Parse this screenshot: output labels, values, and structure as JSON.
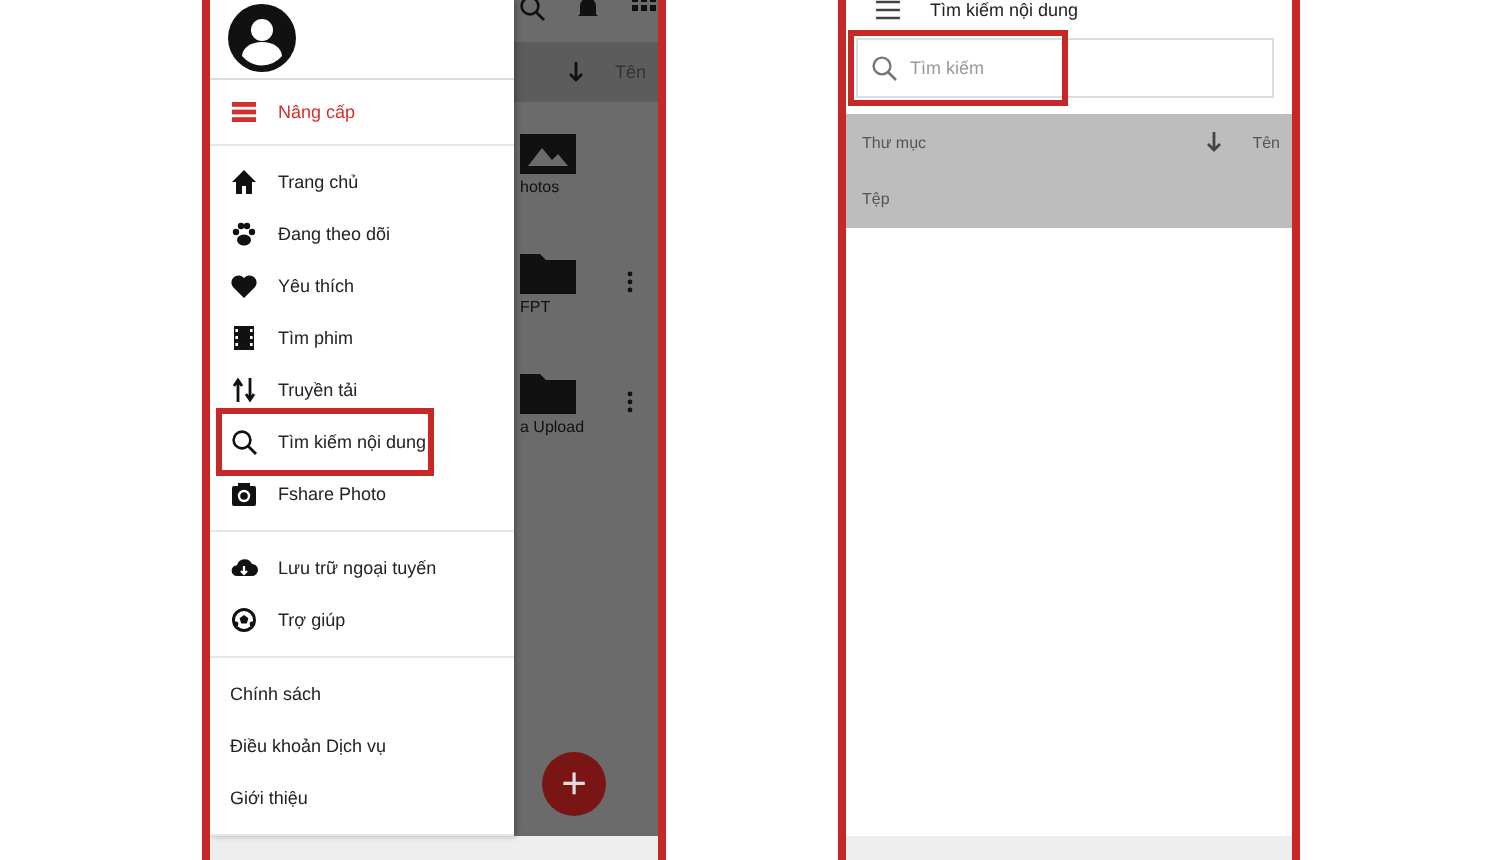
{
  "left_phone": {
    "background_app": {
      "sort_label": "Tên",
      "folders": [
        {
          "name": "hotos",
          "has_menu": false
        },
        {
          "name": "FPT",
          "has_menu": true
        },
        {
          "name": "a Upload",
          "has_menu": true
        }
      ],
      "fab_label": "+"
    },
    "drawer": {
      "upgrade": {
        "label": "Nâng cấp"
      },
      "groups": [
        [
          {
            "label": "Trang chủ",
            "highlighted": false
          },
          {
            "label": "Đang theo dõi",
            "highlighted": false
          },
          {
            "label": "Yêu thích",
            "highlighted": false
          },
          {
            "label": "Tìm phim",
            "highlighted": false
          },
          {
            "label": "Truyền tải",
            "highlighted": false
          },
          {
            "label": "Tìm kiếm nội dung",
            "highlighted": true
          },
          {
            "label": "Fshare Photo",
            "highlighted": false
          }
        ],
        [
          {
            "label": "Lưu trữ ngoại tuyến",
            "highlighted": false
          },
          {
            "label": "Trợ giúp",
            "highlighted": false
          }
        ],
        [
          {
            "label": "Chính sách",
            "highlighted": false
          },
          {
            "label": "Điều khoản Dịch vụ",
            "highlighted": false
          },
          {
            "label": "Giới thiệu",
            "highlighted": false
          }
        ]
      ]
    }
  },
  "right_phone": {
    "title": "Tìm kiếm nội dung",
    "search": {
      "placeholder": "Tìm kiếm",
      "highlighted": true
    },
    "list_header": {
      "section": "Thư mục",
      "sort_label": "Tên"
    },
    "files_section": "Tệp"
  }
}
